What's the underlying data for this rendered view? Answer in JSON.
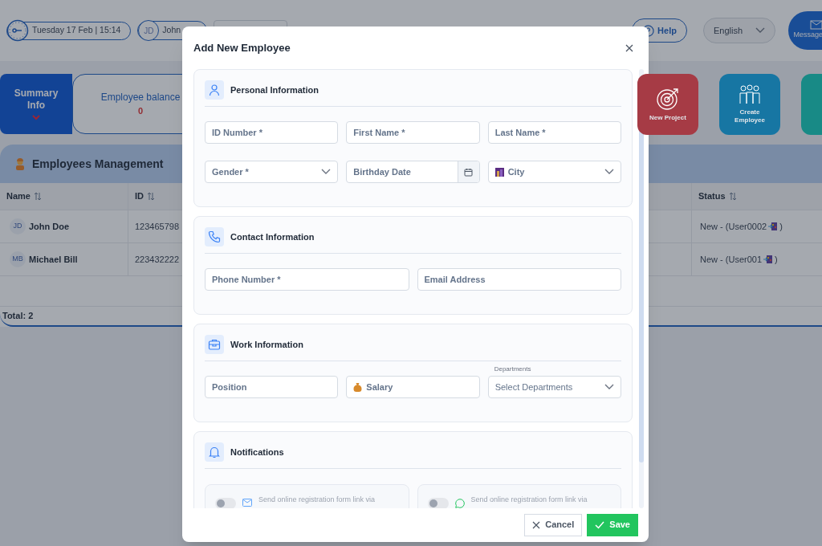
{
  "top_bar": {
    "datetime": "Tuesday 17 Feb | 15:14",
    "user": {
      "initials": "JD",
      "name": "John"
    },
    "help": "Help",
    "language": "English",
    "messages": "Message"
  },
  "summary_tab": {
    "label": "Summary Info",
    "expanded": true
  },
  "balance": {
    "label": "Employee balance",
    "value": "0"
  },
  "tiles": [
    {
      "label": "New Project",
      "kind": "target",
      "color": "#a63b45"
    },
    {
      "label": "Create Employee",
      "kind": "people",
      "color": "#1776a3"
    },
    {
      "kind": "blank",
      "color": "#188a86"
    }
  ],
  "panel": {
    "title": "Employees Management",
    "columns": [
      "Name",
      "ID",
      "Status"
    ],
    "rows": [
      {
        "initials": "JD",
        "name": "John Doe",
        "id": "123465798",
        "status": "New - (User0002",
        "status_end": ")"
      },
      {
        "initials": "MB",
        "name": "Michael Bill",
        "id": "223432222",
        "status": "New - (User001",
        "status_end": ")"
      }
    ],
    "total": "Total: 2"
  },
  "modal": {
    "title": "Add New Employee",
    "sections": [
      {
        "kind": "person",
        "title": "Personal Information",
        "fields": [
          {
            "kind": "text",
            "placeholder": "ID Number *"
          },
          {
            "kind": "text",
            "placeholder": "First Name *"
          },
          {
            "kind": "text",
            "placeholder": "Last Name *"
          },
          {
            "kind": "select",
            "placeholder": "Gender *"
          },
          {
            "kind": "date",
            "placeholder": "Birthday Date"
          },
          {
            "kind": "city-select",
            "placeholder": "City"
          }
        ]
      },
      {
        "kind": "phone",
        "title": "Contact Information",
        "fields": [
          {
            "kind": "text",
            "placeholder": "Phone Number *"
          },
          {
            "kind": "text",
            "placeholder": "Email Address"
          }
        ]
      },
      {
        "kind": "briefcase",
        "title": "Work Information",
        "fields": [
          {
            "kind": "text",
            "placeholder": "Position"
          },
          {
            "kind": "money-text",
            "placeholder": "Salary"
          },
          {
            "kind": "select",
            "label": "Departments",
            "placeholder": "Select Departments"
          }
        ]
      },
      {
        "kind": "bell",
        "title": "Notifications",
        "toggles": [
          {
            "kind": "email",
            "text": "Send online registration form link via",
            "on": false
          },
          {
            "kind": "whatsapp",
            "text": "Send online registration form link via",
            "on": false
          }
        ]
      }
    ],
    "buttons": [
      {
        "kind": "cancel",
        "label": "Cancel"
      },
      {
        "kind": "save",
        "label": "Save"
      }
    ]
  }
}
